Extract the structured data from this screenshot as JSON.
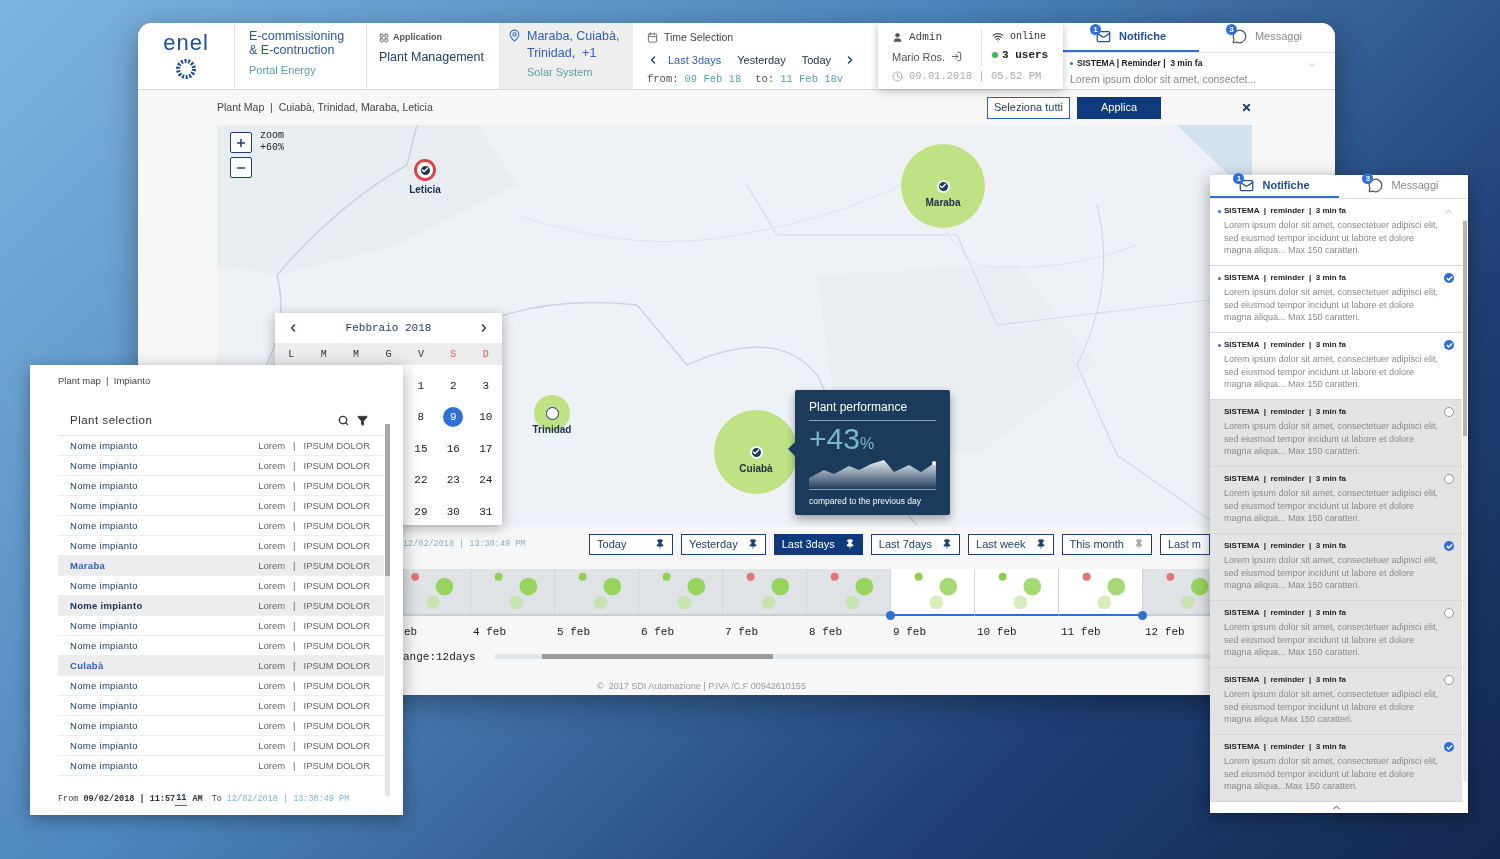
{
  "header": {
    "logo": "enel",
    "portal": {
      "title": "E-commissioning & E-contruction",
      "subtitle": "Portal Energy"
    },
    "application": {
      "label": "Application",
      "value": "Plant Management"
    },
    "location": {
      "plants": "Maraba, Cuiabà, Trinidad,  +1",
      "system": "Solar System"
    },
    "time_selection": {
      "title": "Time Selection",
      "presets": [
        {
          "label": "Last 3days",
          "selected": true
        },
        {
          "label": "Yesterday",
          "selected": false
        },
        {
          "label": "Today",
          "selected": false
        }
      ],
      "from_label": "from:",
      "from": "09 Feb 18",
      "to_label": "to:",
      "to": "11 Feb 18v"
    },
    "user": {
      "role": "Admin",
      "name": "Mario Ros.",
      "status": "online",
      "users": "3 users",
      "datetime": "09.01.2018 | 05.52 PM"
    },
    "notifications": {
      "tabs": [
        {
          "label": "Notifiche",
          "badge": "1",
          "selected": true
        },
        {
          "label": "Messaggi",
          "badge": "3",
          "selected": false
        }
      ],
      "latest": {
        "title": "SISTEMA | Reminder |  3 min fa",
        "text": "Lorem ipsum dolor sit amet, consectet...",
        "unread": true
      }
    }
  },
  "breadcrumb": "Plant Map  |  Cuiabà, Trinidad, Maraba, Leticia",
  "actions": [
    {
      "label": "Seleziona tutti",
      "kind": "outline"
    },
    {
      "label": "Applica",
      "kind": "primary"
    }
  ],
  "map": {
    "zoom_label": "zoom",
    "zoom_value": "+60%",
    "markers": [
      {
        "label": "Leticia",
        "kind": "pin",
        "color": "#e0424b",
        "checked": true
      },
      {
        "label": "Maraba",
        "kind": "large",
        "color": "#bfe285",
        "checked": true
      },
      {
        "label": "Trinidad",
        "kind": "small",
        "color": "#bfe285",
        "checked": false
      },
      {
        "label": "Cuiabà",
        "kind": "large",
        "color": "#bfe285",
        "checked": true
      }
    ],
    "tooltip": {
      "title": "Plant performance",
      "value": "+43",
      "unit": "%",
      "caption": "compared to the previous day"
    }
  },
  "calendar": {
    "month": "Febbraio 2018",
    "weekdays": [
      {
        "label": "L",
        "weekend": false
      },
      {
        "label": "M",
        "weekend": false
      },
      {
        "label": "M",
        "weekend": false
      },
      {
        "label": "G",
        "weekend": false
      },
      {
        "label": "V",
        "weekend": false
      },
      {
        "label": "S",
        "weekend": true
      },
      {
        "label": "D",
        "weekend": true
      }
    ],
    "weeks": [
      [
        {
          "day": "1",
          "selected": false
        },
        {
          "day": "2",
          "selected": false
        },
        {
          "day": "3",
          "selected": false
        }
      ],
      [
        {
          "day": "8",
          "selected": false
        },
        {
          "day": "9",
          "selected": true
        },
        {
          "day": "10",
          "selected": false
        }
      ],
      [
        {
          "day": "15",
          "selected": false
        },
        {
          "day": "16",
          "selected": false
        },
        {
          "day": "17",
          "selected": false
        }
      ],
      [
        {
          "day": "22",
          "selected": false
        },
        {
          "day": "23",
          "selected": false
        },
        {
          "day": "24",
          "selected": false
        }
      ],
      [
        {
          "day": "29",
          "selected": false
        },
        {
          "day": "30",
          "selected": false
        },
        {
          "day": "31",
          "selected": false
        }
      ]
    ]
  },
  "timeline": {
    "to_datetime": "12/02/2018 | 13:30:49 PM",
    "presets": [
      {
        "label": "Today",
        "selected": false,
        "pinned": true
      },
      {
        "label": "Yesterday",
        "selected": false,
        "pinned": true
      },
      {
        "label": "Last 3days",
        "selected": true,
        "pinned": true
      },
      {
        "label": "Last 7days",
        "selected": false,
        "pinned": true
      },
      {
        "label": "Last week",
        "selected": false,
        "pinned": true
      },
      {
        "label": "This month",
        "selected": false,
        "pinned": false
      },
      {
        "label": "Last m",
        "selected": false
      }
    ],
    "days": [
      {
        "label": "eb",
        "color": "#e57373",
        "in_range": false
      },
      {
        "label": "4 feb",
        "color": "#8fd14f",
        "in_range": false
      },
      {
        "label": "5 feb",
        "color": "#8fd14f",
        "in_range": false
      },
      {
        "label": "6 feb",
        "color": "#8fd14f",
        "in_range": false
      },
      {
        "label": "7 feb",
        "color": "#e57373",
        "in_range": false
      },
      {
        "label": "8 feb",
        "color": "#e57373",
        "in_range": false
      },
      {
        "label": "9 feb",
        "color": "#8fd14f",
        "in_range": true
      },
      {
        "label": "10 feb",
        "color": "#8fd14f",
        "in_range": true
      },
      {
        "label": "11 feb",
        "color": "#e57373",
        "in_range": true
      },
      {
        "label": "12 feb",
        "color": "#e57373",
        "in_range": false
      }
    ],
    "range_label": "ange:12days"
  },
  "footer": "©  2017 SDI Automazione | P.IVA /C.F 00942610155",
  "plant_panel": {
    "breadcrumb": "Plant map  |  Impianto",
    "title": "Plant selection",
    "rows": [
      {
        "name": "Nome impianto",
        "info": "Lorem   |   IPSUM DOLOR",
        "selected": false,
        "kind": "plant"
      },
      {
        "name": "Nome impianto",
        "info": "Lorem   |   IPSUM DOLOR",
        "selected": false,
        "kind": "plant"
      },
      {
        "name": "Nome impianto",
        "info": "Lorem   |   IPSUM DOLOR",
        "selected": false,
        "kind": "plant"
      },
      {
        "name": "Nome impianto",
        "info": "Lorem   |   IPSUM DOLOR",
        "selected": false,
        "kind": "plant"
      },
      {
        "name": "Nome impianto",
        "info": "Lorem   |   IPSUM DOLOR",
        "selected": false,
        "kind": "plant"
      },
      {
        "name": "Nome impianto",
        "info": "Lorem   |   IPSUM DOLOR",
        "selected": false,
        "kind": "plant"
      },
      {
        "name": "Maraba",
        "info": "Lorem   |   IPSUM DOLOR",
        "selected": true,
        "kind": "location"
      },
      {
        "name": "Nome impianto",
        "info": "Lorem   |   IPSUM DOLOR",
        "selected": false,
        "kind": "plant"
      },
      {
        "name": "Nome impianto",
        "info": "Lorem   |   IPSUM DOLOR",
        "selected": true,
        "kind": "plant"
      },
      {
        "name": "Nome impianto",
        "info": "Lorem   |   IPSUM DOLOR",
        "selected": false,
        "kind": "plant"
      },
      {
        "name": "Nome impianto",
        "info": "Lorem   |   IPSUM DOLOR",
        "selected": false,
        "kind": "plant"
      },
      {
        "name": "Culabà",
        "info": "Lorem   |   IPSUM DOLOR",
        "selected": true,
        "kind": "location"
      },
      {
        "name": "Nome impianto",
        "info": "Lorem   |   IPSUM DOLOR",
        "selected": false,
        "kind": "plant"
      },
      {
        "name": "Nome impianto",
        "info": "Lorem   |   IPSUM DOLOR",
        "selected": false,
        "kind": "plant"
      },
      {
        "name": "Nome impianto",
        "info": "Lorem   |   IPSUM DOLOR",
        "selected": false,
        "kind": "plant"
      },
      {
        "name": "Nome impianto",
        "info": "Lorem   |   IPSUM DOLOR",
        "selected": false,
        "kind": "plant"
      },
      {
        "name": "Nome impianto",
        "info": "Lorem   |   IPSUM DOLOR",
        "selected": false,
        "kind": "plant"
      }
    ],
    "from_label": "From",
    "from": "09/02/2018 | 11:57",
    "from_seconds": "11",
    "from_meridiem": "AM",
    "to_label": "To",
    "to": "12/02/2018 | 13:30:49 PM"
  },
  "notification_panel": {
    "tabs": [
      {
        "label": "Notifiche",
        "badge": "1",
        "selected": true
      },
      {
        "label": "Messaggi",
        "badge": "3",
        "selected": false
      }
    ],
    "items": [
      {
        "title": "SISTEMA  |  reminder  |  3 min fa",
        "text": "Lorem ipsum dolor sit amet, consectetuer  adipisci elit, sed eiusmod tempor incidunt ut labore et dolore magna aliqua... Max 150 caratteri.",
        "unread": true,
        "kind": "collapsible"
      },
      {
        "title": "SISTEMA  |  reminder  |  3 min fa",
        "text": "Lorem ipsum dolor sit amet, consectetuer  adipisci elit, sed eiusmod tempor incidunt ut labore et dolore magna aliqua... Max 150 caratteri.",
        "unread": true,
        "kind": "selectable",
        "checked": true
      },
      {
        "title": "SISTEMA  |  reminder  |  3 min fa",
        "text": "Lorem ipsum dolor sit amet, consectetuer  adipisci elit, sed eiusmod tempor incidunt ut labore et dolore magna aliqua... Max 150 caratteri.",
        "unread": true,
        "kind": "selectable",
        "checked": true
      },
      {
        "title": "SISTEMA  |  reminder  |  3 min fa",
        "text": "Lorem ipsum dolor sit amet, consectetuer  adipisci elit, sed eiusmod tempor incidunt ut labore et dolore magna aliqua... Max 150 caratteri.",
        "unread": false,
        "kind": "selectable",
        "checked": false
      },
      {
        "title": "SISTEMA  |  reminder  |  3 min fa",
        "text": "Lorem ipsum dolor sit amet, consectetuer  adipisci elit, sed eiusmod tempor incidunt ut labore et dolore magna aliqua... Max 150 caratteri.",
        "unread": false,
        "kind": "selectable",
        "checked": false
      },
      {
        "title": "SISTEMA  |  reminder  |  3 min fa",
        "text": "Lorem ipsum dolor sit amet, consectetuer  adipisci elit, sed eiusmod tempor incidunt ut labore et dolore magna aliqua... Max 150 caratteri.",
        "unread": false,
        "kind": "selectable",
        "checked": true
      },
      {
        "title": "SISTEMA  |  reminder  |  3 min fa",
        "text": "Lorem ipsum dolor sit amet, consectetuer  adipisci elit, sed eiusmod tempor incidunt ut labore et dolore magna aliqua... Max 150 caratteri.",
        "unread": false,
        "kind": "selectable",
        "checked": false
      },
      {
        "title": "SISTEMA  |  reminder  |  3 min fa",
        "text": "Lorem ipsum dolor sit amet, consectetuer  adipisci elit, sed eiusmod tempor incidunt ut labore et dolore magna aliqua  Max 150 caratteri.",
        "unread": false,
        "kind": "selectable",
        "checked": false
      },
      {
        "title": "SISTEMA  |  reminder  |  3 min fa",
        "text": "Lorem ipsum dolor sit amet, consectetuer  adipisci elit, sed eiusmod tempor incidunt ut labore et dolore magna aliqua...Max 150 caratteri.",
        "unread": false,
        "kind": "selectable",
        "checked": true
      }
    ]
  }
}
